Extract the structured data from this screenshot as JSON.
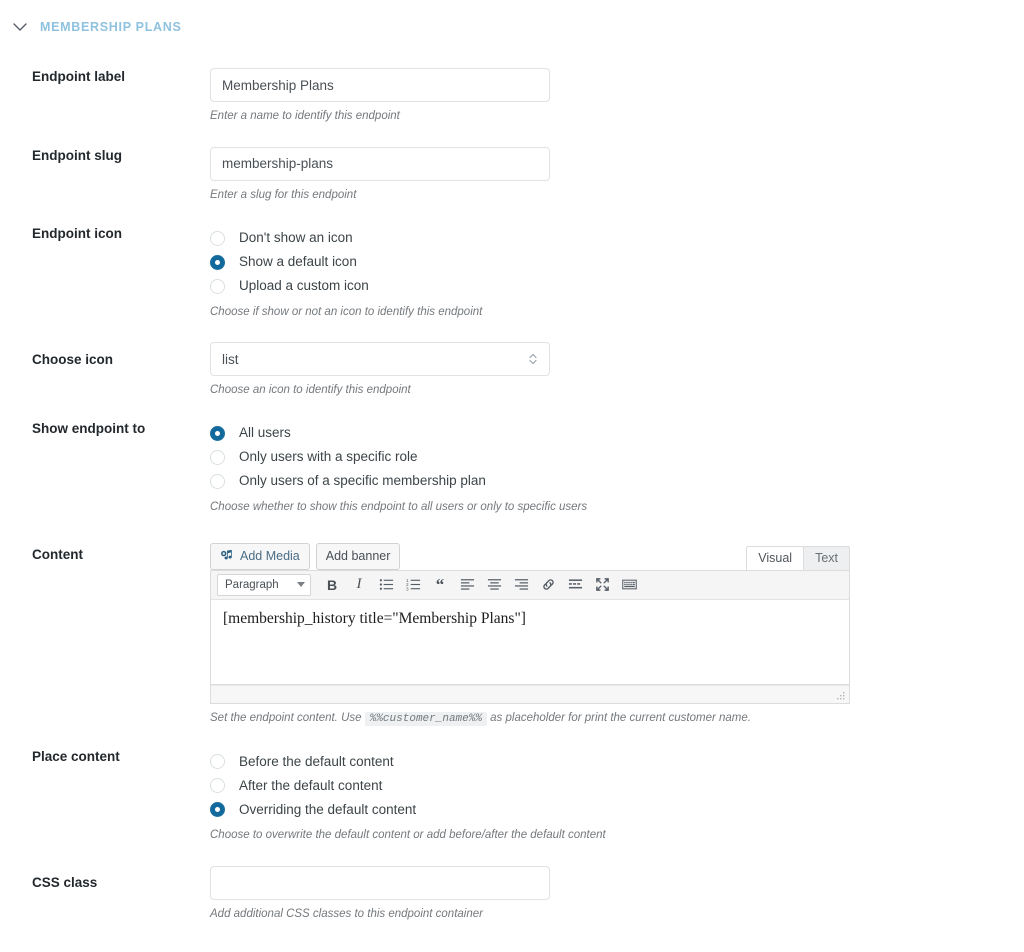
{
  "section": {
    "title": "MEMBERSHIP PLANS",
    "chevron_icon": "chevron-down-icon",
    "accent_color": "#8fc2de"
  },
  "theme": {
    "radio_selected_color": "#13699c",
    "label_color": "#23282d",
    "help_text_color": "#74797d",
    "input_border_color": "#dfe3e6"
  },
  "fields": {
    "endpoint_label": {
      "label": "Endpoint label",
      "value": "Membership Plans",
      "placeholder": "",
      "help": "Enter a name to identify this endpoint"
    },
    "endpoint_slug": {
      "label": "Endpoint slug",
      "value": "membership-plans",
      "placeholder": "",
      "help": "Enter a slug for this endpoint"
    },
    "endpoint_icon": {
      "label": "Endpoint icon",
      "help": "Choose if show or not an icon to identify this endpoint",
      "options": [
        {
          "label": "Don't show an icon",
          "selected": false
        },
        {
          "label": "Show a default icon",
          "selected": true
        },
        {
          "label": "Upload a custom icon",
          "selected": false
        }
      ]
    },
    "choose_icon": {
      "label": "Choose icon",
      "value": "list",
      "help": "Choose an icon to identify this endpoint",
      "stepper_icon": "chevron-up-down-icon"
    },
    "show_endpoint_to": {
      "label": "Show endpoint to",
      "help": "Choose whether to show this endpoint to all users or only to specific users",
      "options": [
        {
          "label": "All users",
          "selected": true
        },
        {
          "label": "Only users with a specific role",
          "selected": false
        },
        {
          "label": "Only users of a specific membership plan",
          "selected": false
        }
      ]
    },
    "content": {
      "label": "Content",
      "add_media_label": "Add Media",
      "add_media_icon": "wordpress-media-icon",
      "add_banner_label": "Add banner",
      "tabs": [
        {
          "label": "Visual",
          "active": true
        },
        {
          "label": "Text",
          "active": false
        }
      ],
      "format_select": "Paragraph",
      "toolbar_buttons": [
        {
          "name": "bold-icon",
          "title": "Bold"
        },
        {
          "name": "italic-icon",
          "title": "Italic"
        },
        {
          "name": "bulleted-list-icon",
          "title": "Bulleted list"
        },
        {
          "name": "numbered-list-icon",
          "title": "Numbered list"
        },
        {
          "name": "blockquote-icon",
          "title": "Blockquote"
        },
        {
          "name": "align-left-icon",
          "title": "Align left"
        },
        {
          "name": "align-center-icon",
          "title": "Align center"
        },
        {
          "name": "align-right-icon",
          "title": "Align right"
        },
        {
          "name": "link-icon",
          "title": "Insert link"
        },
        {
          "name": "read-more-icon",
          "title": "Insert Read More tag"
        },
        {
          "name": "fullscreen-icon",
          "title": "Distraction-free writing mode"
        },
        {
          "name": "toolbar-toggle-icon",
          "title": "Toolbar Toggle"
        }
      ],
      "body_text": "[membership_history title=\"Membership Plans\"]",
      "resize_handle_icon": "resize-handle-icon",
      "help_prefix": "Set the endpoint content. Use",
      "help_code": "%%customer_name%%",
      "help_suffix": "as placeholder for print the current customer name."
    },
    "place_content": {
      "label": "Place content",
      "help": "Choose to overwrite the default content or add before/after the default content",
      "options": [
        {
          "label": "Before the default content",
          "selected": false
        },
        {
          "label": "After the default content",
          "selected": false
        },
        {
          "label": "Overriding the default content",
          "selected": true
        }
      ]
    },
    "css_class": {
      "label": "CSS class",
      "value": "",
      "placeholder": "",
      "help": "Add additional CSS classes to this endpoint container"
    }
  }
}
